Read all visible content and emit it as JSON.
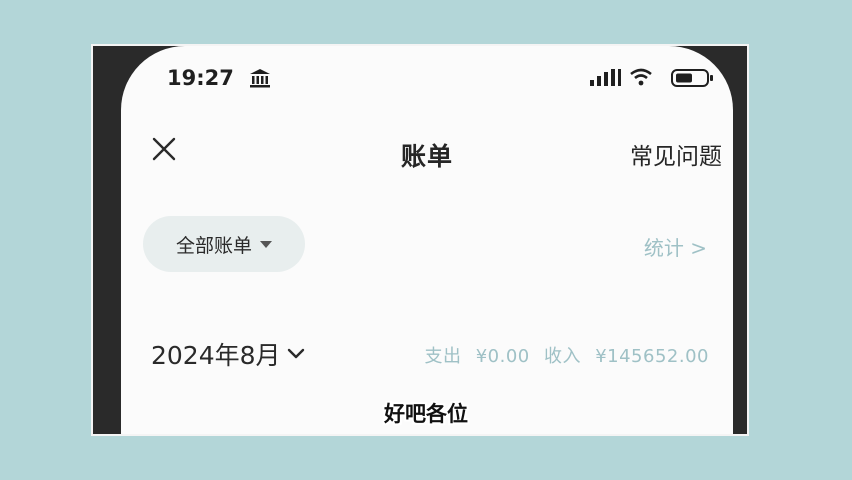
{
  "status_bar": {
    "time": "19:27",
    "icons": [
      "bank-icon",
      "signal-icon",
      "wifi-icon",
      "battery-icon"
    ]
  },
  "header": {
    "close_icon": "close-icon",
    "title": "账单",
    "faq": "常见问题"
  },
  "filter": {
    "label": "全部账单",
    "stats": "统计 >"
  },
  "month": {
    "label": "2024年8月",
    "expense_label": "支出",
    "expense_amount": "¥0.00",
    "income_label": "收入",
    "income_amount": "¥145652.00"
  },
  "subtitle": "好吧各位",
  "colors": {
    "background": "#b3d6d8",
    "accent_muted": "#9fc1c6",
    "text": "#262626"
  }
}
